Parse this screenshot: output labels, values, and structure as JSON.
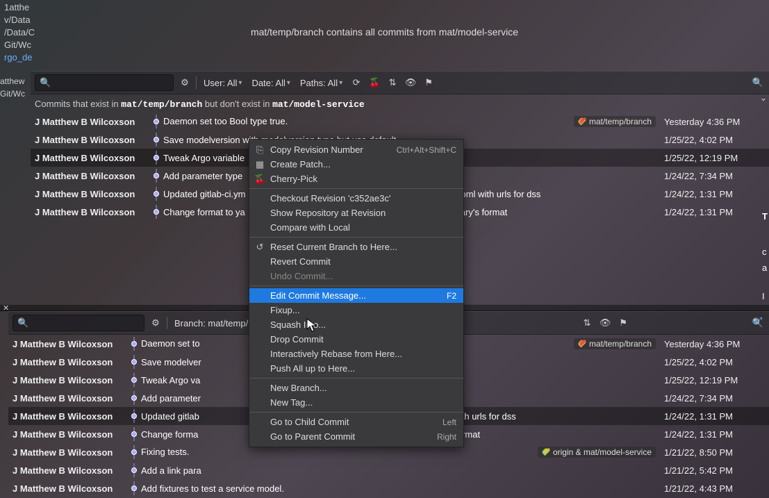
{
  "topPaths": [
    "1atthe",
    "v/Data",
    "/Data/C",
    "Git/Wc"
  ],
  "topLink": "rgo_de",
  "banner": "mat/temp/branch contains all commits from mat/model-service",
  "leftLabels": [
    "atthew",
    "Git/Wc"
  ],
  "filters": {
    "user": "User: All",
    "date": "Date: All",
    "paths": "Paths: All",
    "branch": "Branch: mat/temp/"
  },
  "infoBar": {
    "prefix": "Commits that exist in ",
    "b1": "mat/temp/branch",
    "mid": " but don't exist in ",
    "b2": "mat/model-service"
  },
  "tags": {
    "top": "mat/temp/branch",
    "bottom1": "mat/temp/branch",
    "bottom2": "origin & mat/model-service"
  },
  "commitsTop": [
    {
      "author": "J Matthew B Wilcoxson",
      "msg": "Daemon set too Bool type true.",
      "date": "Yesterday 4:36 PM",
      "tag": "top"
    },
    {
      "author": "J Matthew B Wilcoxson",
      "msg": "Save modelversion with modelversion type but use default.",
      "date": "1/25/22, 4:02 PM"
    },
    {
      "author": "J Matthew B Wilcoxson",
      "msg": "Tweak Argo variable",
      "date": "1/25/22, 12:19 PM",
      "selected": true
    },
    {
      "author": "J Matthew B Wilcoxson",
      "msg": "Add parameter type",
      "date": "1/24/22, 7:34 PM"
    },
    {
      "author": "J Matthew B Wilcoxson",
      "msg": "Updated gitlab-ci.ym",
      "msg2": "oml with urls for dss",
      "date": "1/24/22, 1:31 PM"
    },
    {
      "author": "J Matthew B Wilcoxson",
      "msg": "Change format to ya",
      "msg2": "ary's format",
      "date": "1/24/22, 1:31 PM"
    }
  ],
  "commitsBottom": [
    {
      "author": "J Matthew B Wilcoxson",
      "msg": "Daemon set to",
      "date": "Yesterday 4:36 PM",
      "tag": "bottom1"
    },
    {
      "author": "J Matthew B Wilcoxson",
      "msg": "Save modelver",
      "date": "1/25/22, 4:02 PM"
    },
    {
      "author": "J Matthew B Wilcoxson",
      "msg": "Tweak Argo va",
      "date": "1/25/22, 12:19 PM"
    },
    {
      "author": "J Matthew B Wilcoxson",
      "msg": "Add parameter",
      "date": "1/24/22, 7:34 PM"
    },
    {
      "author": "J Matthew B Wilcoxson",
      "msg": "Updated gitlab",
      "msg2": "lafni.toml with urls for dss",
      "date": "1/24/22, 1:31 PM",
      "selected": true
    },
    {
      "author": "J Matthew B Wilcoxson",
      "msg": "Change forma",
      "msg2": "n library's format",
      "date": "1/24/22, 1:31 PM"
    },
    {
      "author": "J Matthew B Wilcoxson",
      "msg": "Fixing tests.",
      "date": "1/21/22, 8:50 PM",
      "tag": "bottom2"
    },
    {
      "author": "J Matthew B Wilcoxson",
      "msg": "Add a link para",
      "date": "1/21/22, 5:42 PM"
    },
    {
      "author": "J Matthew B Wilcoxson",
      "msg": "Add fixtures to test a service model.",
      "date": "1/21/22, 4:43 PM"
    }
  ],
  "rightPeek": [
    "T",
    "c",
    "a",
    "I"
  ],
  "menu": [
    {
      "label": "Copy Revision Number",
      "shortcut": "Ctrl+Alt+Shift+C",
      "icon": "copy"
    },
    {
      "label": "Create Patch...",
      "icon": "patch"
    },
    {
      "label": "Cherry-Pick",
      "icon": "cherry"
    },
    {
      "sep": true
    },
    {
      "label": "Checkout Revision 'c352ae3c'"
    },
    {
      "label": "Show Repository at Revision"
    },
    {
      "label": "Compare with Local"
    },
    {
      "sep": true
    },
    {
      "label": "Reset Current Branch to Here...",
      "icon": "undo"
    },
    {
      "label": "Revert Commit"
    },
    {
      "label": "Undo Commit...",
      "disabled": true
    },
    {
      "sep": true
    },
    {
      "label": "Edit Commit Message...",
      "shortcut": "F2",
      "highlighted": true
    },
    {
      "label": "Fixup..."
    },
    {
      "label": "Squash Into..."
    },
    {
      "label": "Drop Commit"
    },
    {
      "label": "Interactively Rebase from Here..."
    },
    {
      "label": "Push All up to Here..."
    },
    {
      "sep": true
    },
    {
      "label": "New Branch..."
    },
    {
      "label": "New Tag..."
    },
    {
      "sep": true
    },
    {
      "label": "Go to Child Commit",
      "shortcut": "Left"
    },
    {
      "label": "Go to Parent Commit",
      "shortcut": "Right"
    }
  ]
}
